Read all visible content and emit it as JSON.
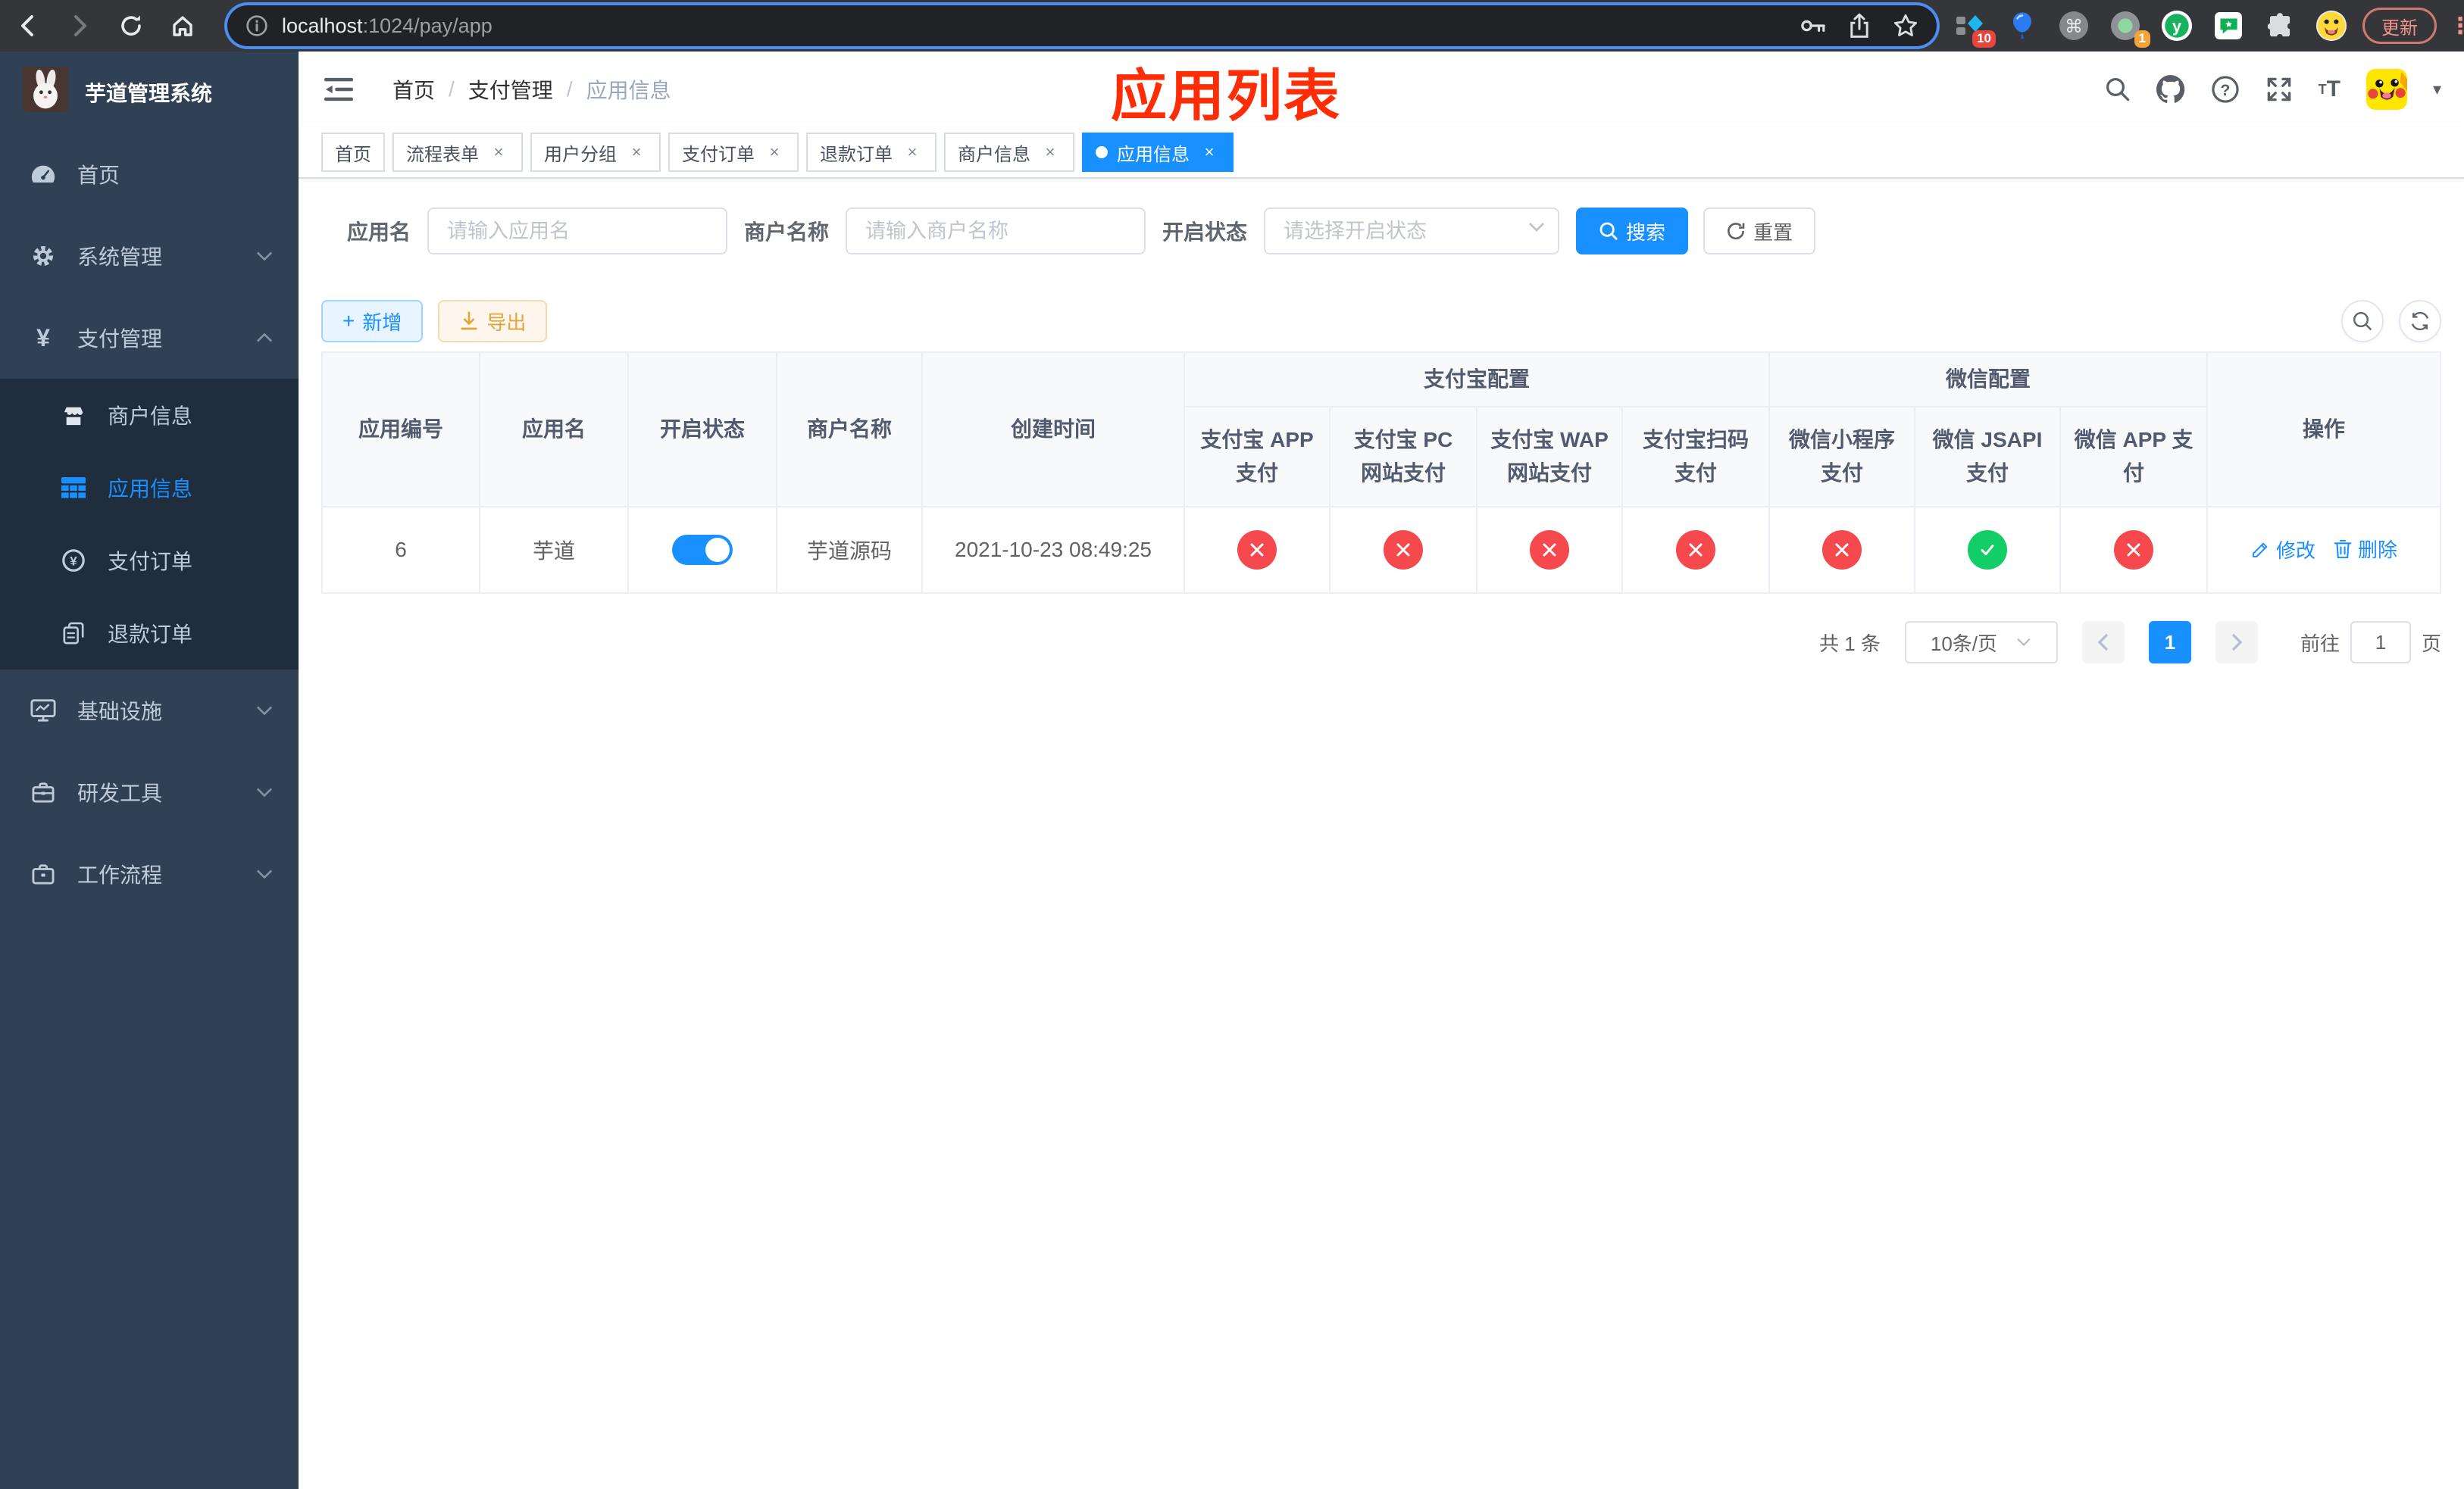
{
  "browser": {
    "url_host": "localhost",
    "url_path": ":1024/pay/app",
    "update_label": "更新",
    "ext_badge_1": "10",
    "ext_badge_2": "1"
  },
  "icons": {
    "close_glyph": "×",
    "kebab_glyph": "⋮",
    "command_glyph": "⌘",
    "yen_glyph": "¥",
    "question_glyph": "?",
    "plus_glyph": "+",
    "y_logo_glyph": "y",
    "fontsize_small": "T",
    "fontsize_big": "T",
    "caret_glyph": "▾"
  },
  "sidebar": {
    "app_title": "芋道管理系统",
    "menu": [
      {
        "label": "首页"
      },
      {
        "label": "系统管理"
      },
      {
        "label": "支付管理"
      },
      {
        "label": "基础设施"
      },
      {
        "label": "研发工具"
      },
      {
        "label": "工作流程"
      }
    ],
    "submenu": [
      {
        "label": "商户信息"
      },
      {
        "label": "应用信息"
      },
      {
        "label": "支付订单"
      },
      {
        "label": "退款订单"
      }
    ]
  },
  "navbar": {
    "breadcrumb": [
      "首页",
      "支付管理",
      "应用信息"
    ],
    "annotation": "应用列表"
  },
  "tags": [
    {
      "label": "首页"
    },
    {
      "label": "流程表单"
    },
    {
      "label": "用户分组"
    },
    {
      "label": "支付订单"
    },
    {
      "label": "退款订单"
    },
    {
      "label": "商户信息"
    },
    {
      "label": "应用信息"
    }
  ],
  "filters": {
    "app_name_label": "应用名",
    "app_name_placeholder": "请输入应用名",
    "merchant_label": "商户名称",
    "merchant_placeholder": "请输入商户名称",
    "status_label": "开启状态",
    "status_placeholder": "请选择开启状态",
    "search_label": "搜索",
    "reset_label": "重置"
  },
  "toolbar": {
    "add_label": "新增",
    "export_label": "导出"
  },
  "table": {
    "headers": {
      "app_id": "应用编号",
      "app_name": "应用名",
      "status": "开启状态",
      "merchant": "商户名称",
      "created": "创建时间",
      "alipay_group": "支付宝配置",
      "wechat_group": "微信配置",
      "alipay_app": "支付宝 APP 支付",
      "alipay_pc": "支付宝 PC 网站支付",
      "alipay_wap": "支付宝 WAP 网站支付",
      "alipay_qr": "支付宝扫码支付",
      "wx_mini": "微信小程序支付",
      "wx_jsapi": "微信 JSAPI 支付",
      "wx_app": "微信 APP 支付",
      "actions": "操作"
    },
    "row": {
      "app_id": "6",
      "app_name": "芋道",
      "status_on": true,
      "merchant": "芋道源码",
      "created": "2021-10-23 08:49:25",
      "pay_channels": [
        "off",
        "off",
        "off",
        "off",
        "off",
        "on",
        "off"
      ],
      "edit_label": "修改",
      "delete_label": "删除"
    }
  },
  "pagination": {
    "total": "共 1 条",
    "page_size": "10条/页",
    "current_page": "1",
    "goto_label": "前往",
    "goto_value": "1",
    "page_unit": "页"
  },
  "colors": {
    "primary": "#1890ff",
    "success": "#13ce66",
    "danger": "#f5494e",
    "warning": "#e6a23c",
    "sidebar_bg": "#304156",
    "submenu_bg": "#1f2d3d",
    "annotation_red": "#ff2d05"
  }
}
